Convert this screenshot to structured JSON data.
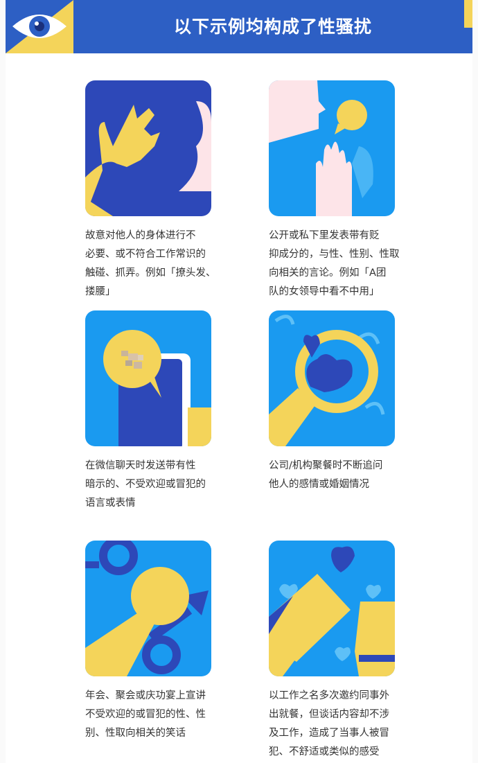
{
  "header": {
    "title": "以下示例均构成了性骚扰",
    "icon": "eye-icon"
  },
  "colors": {
    "blue_dark": "#2d48b8",
    "blue_light": "#1a9af0",
    "yellow": "#f4d45a",
    "pink": "#fde4e8",
    "header_blue": "#2d5fc4"
  },
  "examples": [
    {
      "icon": "touching-hand-icon",
      "text": "故意对他人的身体进行不\n必要、或不符合工作常识的\n触碰、抓弄。例如「撩头发、\n搂腰」"
    },
    {
      "icon": "speaking-hand-icon",
      "text": "公开或私下里发表带有贬\n抑成分的，与性、性别、性取\n向相关的言论。例如「A团\n队的女领导中看不中用」"
    },
    {
      "icon": "chat-phone-icon",
      "text": "在微信聊天时发送带有性\n暗示的、不受欢迎或冒犯的\n语言或表情"
    },
    {
      "icon": "magnifier-heart-icon",
      "text": "公司/机构聚餐时不断追问\n他人的感情或婚姻情况"
    },
    {
      "icon": "microphone-gender-icon",
      "text": "年会、聚会或庆功宴上宣讲\n不受欢迎的或冒犯的性、性\n别、性取向相关的笑话"
    },
    {
      "icon": "toast-glasses-icon",
      "text": "以工作之名多次邀约同事外\n出就餐，但谈话内容却不涉\n及工作，造成了当事人被冒\n犯、不舒适或类似的感受"
    }
  ]
}
